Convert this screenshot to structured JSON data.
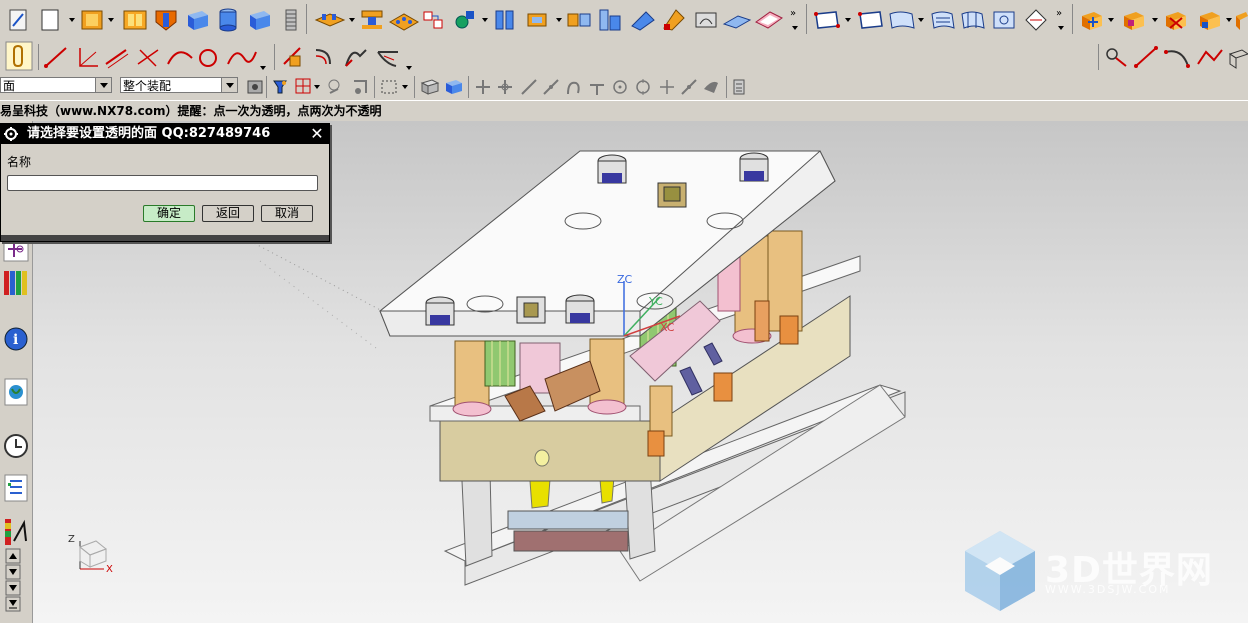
{
  "toolbar": {
    "row1_icons": [
      "sketch-icon",
      "new-part-icon",
      "part-icon",
      "book-icon",
      "shield-icon",
      "box-icon",
      "cylinder-icon",
      "cube-icon",
      "spring-icon",
      "block-stack-icon",
      "slider-icon",
      "grid-plate-icon",
      "move-icon",
      "pin-icon",
      "split-icon",
      "extrude-icon",
      "assembly-icon",
      "surface-icon",
      "color-icon",
      "trim-icon",
      "fill-icon",
      "plane-icon",
      "sheet-icon",
      "face-icon",
      "mesh-icon",
      "grid-surface-icon",
      "sweep-icon",
      "patch-icon",
      "solid-edit-icon",
      "hollow-icon",
      "remove-icon",
      "copy-icon",
      "trim-body-icon"
    ],
    "row2_icons": [
      "snap-icon",
      "line-icon",
      "axis-line-icon",
      "parallel-line-icon",
      "cross-line-icon",
      "arc-icon",
      "circle-icon",
      "spline-icon",
      "trim-curve-icon",
      "offset-curve-icon",
      "bridge-curve-icon",
      "fillet-curve-icon",
      "point-curve-icon",
      "line-tool-icon",
      "arc-tool-icon",
      "polyline-tool-icon",
      "cube-outline-icon"
    ],
    "row3_icons": [
      "camera-icon",
      "filter-icon",
      "select-icon",
      "lasso-icon",
      "box-select-icon",
      "cube-view-icon",
      "render-icon",
      "snap-endpoint-icon",
      "snap-midpoint-icon",
      "snap-line-icon",
      "snap-tangent-icon",
      "snap-curve-icon",
      "snap-perp-icon",
      "snap-center-icon",
      "snap-quadrant-icon",
      "snap-point-icon",
      "snap-existing-icon",
      "snap-bound-icon",
      "calculator-icon"
    ]
  },
  "selection": {
    "filter_value": "面",
    "scope_value": "整个装配"
  },
  "hint": {
    "text": "易呈科技（www.NX78.com）提醒：点一次为透明，点两次为不透明"
  },
  "dialog": {
    "title": "请选择要设置透明的面 QQ:827489746",
    "close_label": "✕",
    "name_label": "名称",
    "name_value": "",
    "ok_label": "确定",
    "back_label": "返回",
    "cancel_label": "取消"
  },
  "viewport": {
    "axis_labels": {
      "zc": "ZC",
      "yc": "YC",
      "xc": "XC"
    },
    "triad": {
      "z": "Z",
      "x": "X"
    }
  },
  "left_bar_icons": [
    "constraint-icon",
    "library-icon",
    "info-icon",
    "web-icon",
    "history-icon",
    "navigator-icon",
    "palette-icon",
    "scroll-up-icon",
    "scroll-down-icon",
    "scroll-end-icon"
  ],
  "watermark": {
    "brand": "3D世界网",
    "url": "WWW.3DSJW.COM"
  },
  "colors": {
    "toolbar_bg": "#d4d0c8",
    "dialog_title_bg": "#000000",
    "ok_button_bg": "#c7ecc7"
  }
}
